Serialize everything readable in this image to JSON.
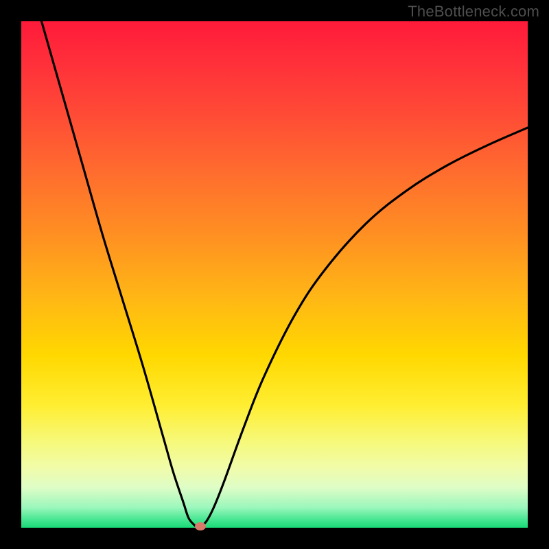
{
  "watermark": "TheBottleneck.com",
  "chart_data": {
    "type": "line",
    "title": "",
    "xlabel": "",
    "ylabel": "",
    "xlim": [
      0,
      100
    ],
    "ylim": [
      0,
      100
    ],
    "curve": {
      "name": "bottleneck-curve",
      "x": [
        4,
        8,
        12,
        16,
        20,
        24,
        28,
        30,
        32,
        33,
        34,
        34.5,
        35.3,
        36.5,
        38,
        40,
        44,
        48,
        54,
        60,
        68,
        76,
        84,
        92,
        100
      ],
      "y": [
        100,
        86,
        72,
        58,
        45,
        32,
        18,
        11,
        5,
        2,
        0.7,
        0.3,
        0.3,
        1.2,
        4,
        9,
        20,
        30,
        42,
        51,
        60,
        66.5,
        71.5,
        75.5,
        79
      ]
    },
    "marker": {
      "x": 35.3,
      "y": 0.3
    },
    "colors": {
      "gradient_top": "#ff1a3a",
      "gradient_mid": "#ffd800",
      "gradient_bottom": "#19d976",
      "curve": "#000000",
      "marker": "#d87a6a",
      "frame": "#000000"
    }
  }
}
